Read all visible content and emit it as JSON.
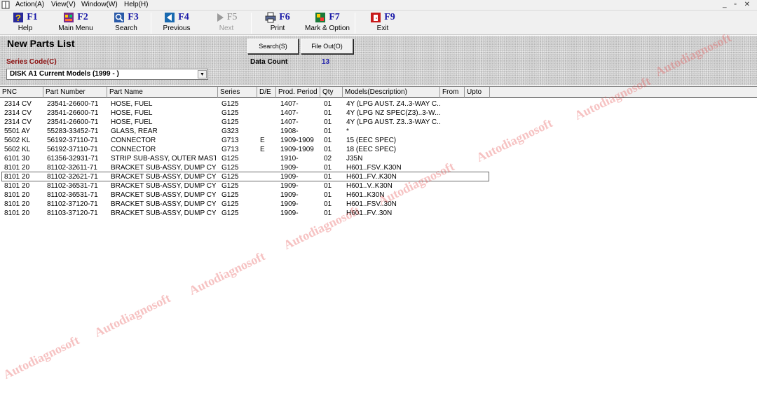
{
  "menubar": {
    "items": [
      "Action(A)",
      "View(V)",
      "Window(W)",
      "Help(H)"
    ],
    "controls": "_ ▫ ✕"
  },
  "toolbar": {
    "buttons": [
      {
        "key": "F1",
        "label": "Help",
        "icon": "help-icon"
      },
      {
        "key": "F2",
        "label": "Main Menu",
        "icon": "main-menu-icon"
      },
      {
        "key": "F3",
        "label": "Search",
        "icon": "search-icon"
      },
      {
        "key": "F4",
        "label": "Previous",
        "icon": "previous-icon"
      },
      {
        "key": "F5",
        "label": "Next",
        "icon": "next-icon",
        "disabled": true
      },
      {
        "key": "F6",
        "label": "Print",
        "icon": "printer-icon"
      },
      {
        "key": "F7",
        "label": "Mark & Option",
        "icon": "mark-option-icon"
      },
      {
        "key": "F9",
        "label": "Exit",
        "icon": "exit-icon"
      }
    ]
  },
  "header": {
    "title": "New Parts List",
    "search_button": "Search(S)",
    "file_out_button": "File Out(O)",
    "series_code_label": "Series Code(C)",
    "series_code_value": "DISK A1 Current Models (1999 - )",
    "data_count_label": "Data Count",
    "data_count_value": "13"
  },
  "table": {
    "columns": [
      "PNC",
      "Part Number",
      "Part Name",
      "Series",
      "D/E",
      "Prod. Period",
      "Qty",
      "Models(Description)",
      "From",
      "Upto"
    ],
    "rows": [
      [
        "2314 CV",
        "23541-26600-71",
        "HOSE, FUEL",
        "G125",
        "",
        "1407-",
        "01",
        "4Y (LPG AUST. Z4..3-WAY C..."
      ],
      [
        "2314 CV",
        "23541-26600-71",
        "HOSE, FUEL",
        "G125",
        "",
        "1407-",
        "01",
        "4Y (LPG NZ SPEC(Z3)..3-W..."
      ],
      [
        "2314 CV",
        "23541-26600-71",
        "HOSE, FUEL",
        "G125",
        "",
        "1407-",
        "01",
        "4Y (LPG AUST. Z3..3-WAY C..."
      ],
      [
        "5501 AY",
        "55283-33452-71",
        "GLASS, REAR",
        "G323",
        "",
        "1908-",
        "01",
        "*"
      ],
      [
        "5602 KL",
        "56192-37110-71",
        "CONNECTOR",
        "G713",
        "E",
        "1909-1909",
        "01",
        "15 (EEC SPEC)"
      ],
      [
        "5602 KL",
        "56192-37110-71",
        "CONNECTOR",
        "G713",
        "E",
        "1909-1909",
        "01",
        "18 (EEC SPEC)"
      ],
      [
        "6101 30",
        "61356-32931-71",
        "STRIP SUB-ASSY, OUTER MAST",
        "G125",
        "",
        "1910-",
        "02",
        "J35N"
      ],
      [
        "8101 20",
        "81102-32611-71",
        "BRACKET SUB-ASSY, DUMP CY...",
        "G125",
        "",
        "1909-",
        "01",
        "H601..FSV..K30N"
      ],
      [
        "8101 20",
        "81102-32621-71",
        "BRACKET SUB-ASSY, DUMP CY...",
        "G125",
        "",
        "1909-",
        "01",
        "H601..FV..K30N"
      ],
      [
        "8101 20",
        "81102-36531-71",
        "BRACKET SUB-ASSY, DUMP CY...",
        "G125",
        "",
        "1909-",
        "01",
        "H601..V..K30N"
      ],
      [
        "8101 20",
        "81102-36531-71",
        "BRACKET SUB-ASSY, DUMP CY...",
        "G125",
        "",
        "1909-",
        "01",
        "H601..K30N"
      ],
      [
        "8101 20",
        "81102-37120-71",
        "BRACKET SUB-ASSY, DUMP CY...",
        "G125",
        "",
        "1909-",
        "01",
        "H601..FSV..30N"
      ],
      [
        "8101 20",
        "81103-37120-71",
        "BRACKET SUB-ASSY, DUMP CY...",
        "G125",
        "",
        "1909-",
        "01",
        "H601..FV..30N"
      ]
    ],
    "selected_row": 8
  },
  "watermark": "Autodiagnosoft",
  "colors": {
    "key_blue": "#1a1aa8",
    "label_red": "#8b1010",
    "watermark": "#e65050"
  }
}
